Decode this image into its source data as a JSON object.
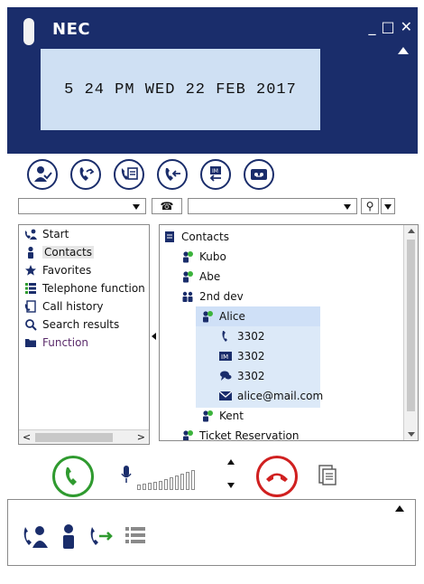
{
  "app": {
    "brand": "NEC",
    "window_controls": {
      "minimize": "_",
      "maximize": "□",
      "close": "✕"
    }
  },
  "display": {
    "lcd_text": "5 24 PM WED 22 FEB 2017"
  },
  "toolbar": {
    "buttons": [
      {
        "icon": "presence-status-icon"
      },
      {
        "icon": "call-forward-icon"
      },
      {
        "icon": "phonebook-icon"
      },
      {
        "icon": "call-pickup-icon"
      },
      {
        "icon": "instant-message-icon"
      },
      {
        "icon": "voicemail-icon"
      }
    ]
  },
  "combos": {
    "left_value": "",
    "phone_glyph": "☎",
    "search_value": "",
    "search_glyph": "⚲"
  },
  "nav": {
    "items": [
      {
        "label": "Start",
        "icon": "start-icon"
      },
      {
        "label": "Contacts",
        "icon": "contacts-icon",
        "selected": true
      },
      {
        "label": "Favorites",
        "icon": "star-icon"
      },
      {
        "label": "Telephone function",
        "icon": "telephone-function-icon"
      },
      {
        "label": "Call history",
        "icon": "call-history-icon"
      },
      {
        "label": "Search results",
        "icon": "search-results-icon"
      },
      {
        "label": "Function",
        "icon": "folder-icon"
      }
    ],
    "scroll_left": "<",
    "scroll_right": ">"
  },
  "tree": {
    "root": "Contacts",
    "contacts": [
      {
        "name": "Kubo"
      },
      {
        "name": "Abe"
      },
      {
        "name": "2nd dev"
      },
      {
        "name": "Alice"
      },
      {
        "name": "3302",
        "type": "phone"
      },
      {
        "name": "3302",
        "type": "im"
      },
      {
        "name": "3302",
        "type": "chat"
      },
      {
        "name": "alice@mail.com",
        "type": "email"
      },
      {
        "name": "Kent"
      },
      {
        "name": "Ticket Reservation"
      }
    ]
  },
  "colors": {
    "header_bg": "#1a2d6b",
    "lcd_bg": "#cfe0f3",
    "answer_green": "#2f9a2f",
    "hangup_red": "#d02020",
    "selection_blue": "#cfe0f7"
  },
  "bottom_panel": {
    "icons": [
      "call-contact-icon",
      "person-icon",
      "call-transfer-icon",
      "list-icon"
    ]
  }
}
